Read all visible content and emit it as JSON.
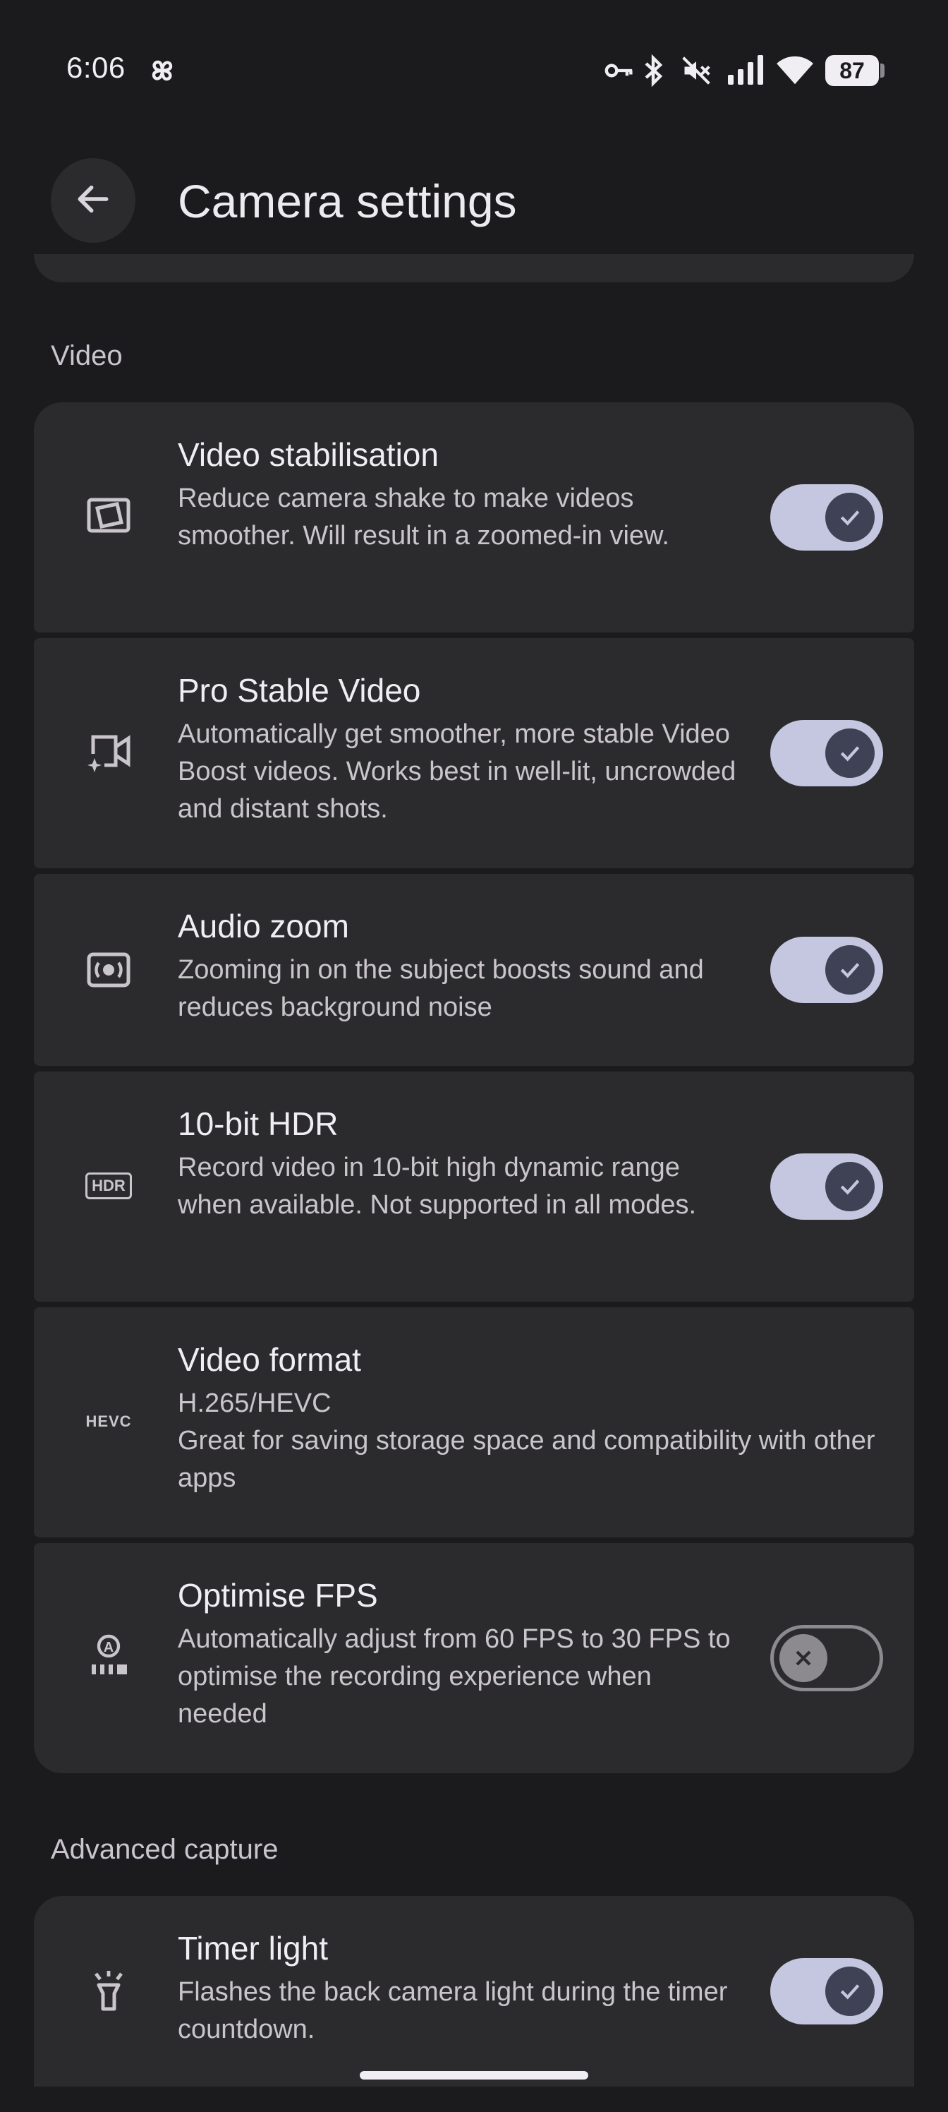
{
  "status_bar": {
    "time": "6:06",
    "battery": "87",
    "icons": [
      "pinwheel-icon",
      "vpn-key-icon",
      "bluetooth-icon",
      "mute-icon",
      "signal-icon",
      "wifi-icon",
      "battery-icon"
    ]
  },
  "app_bar": {
    "back_icon": "arrow-back-icon",
    "title": "Camera settings"
  },
  "sections": {
    "video": {
      "label": "Video",
      "items": [
        {
          "title": "Video stabilisation",
          "desc": "Reduce camera shake to make videos smoother. Will result in a zoomed-in view.",
          "icon": "stabilisation-icon",
          "toggle": "on"
        },
        {
          "title": "Pro Stable Video",
          "desc": "Automatically get smoother, more stable Video Boost videos. Works best in well-lit, uncrowded and distant shots.",
          "icon": "video-sparkle-icon",
          "toggle": "on"
        },
        {
          "title": "Audio zoom",
          "desc": "Zooming in on the subject boosts sound and reduces background noise",
          "icon": "audio-zoom-icon",
          "toggle": "on"
        },
        {
          "title": "10-bit HDR",
          "desc": "Record video in 10-bit high dynamic range when available. Not supported in all modes.",
          "icon": "hdr-icon",
          "icon_text": "HDR",
          "toggle": "on"
        },
        {
          "title": "Video format",
          "value": "H.265/HEVC",
          "desc": "Great for saving storage space and compatibility with other apps",
          "icon": "hevc-icon",
          "icon_text": "HEVC"
        },
        {
          "title": "Optimise FPS",
          "desc": "Automatically adjust from 60 FPS to 30 FPS to optimise the recording experience when needed",
          "icon": "auto-fps-icon",
          "toggle": "off"
        }
      ]
    },
    "advanced": {
      "label": "Advanced capture",
      "items": [
        {
          "title": "Timer light",
          "desc": "Flashes the back camera light during the timer countdown.",
          "icon": "flashlight-icon",
          "toggle": "on"
        }
      ]
    }
  },
  "colors": {
    "background": "#1b1b1d",
    "card": "#2b2b2e",
    "toggle_on_track": "#c4c7df",
    "toggle_on_knob": "#3e4254",
    "toggle_off": "#8c8a8f"
  }
}
